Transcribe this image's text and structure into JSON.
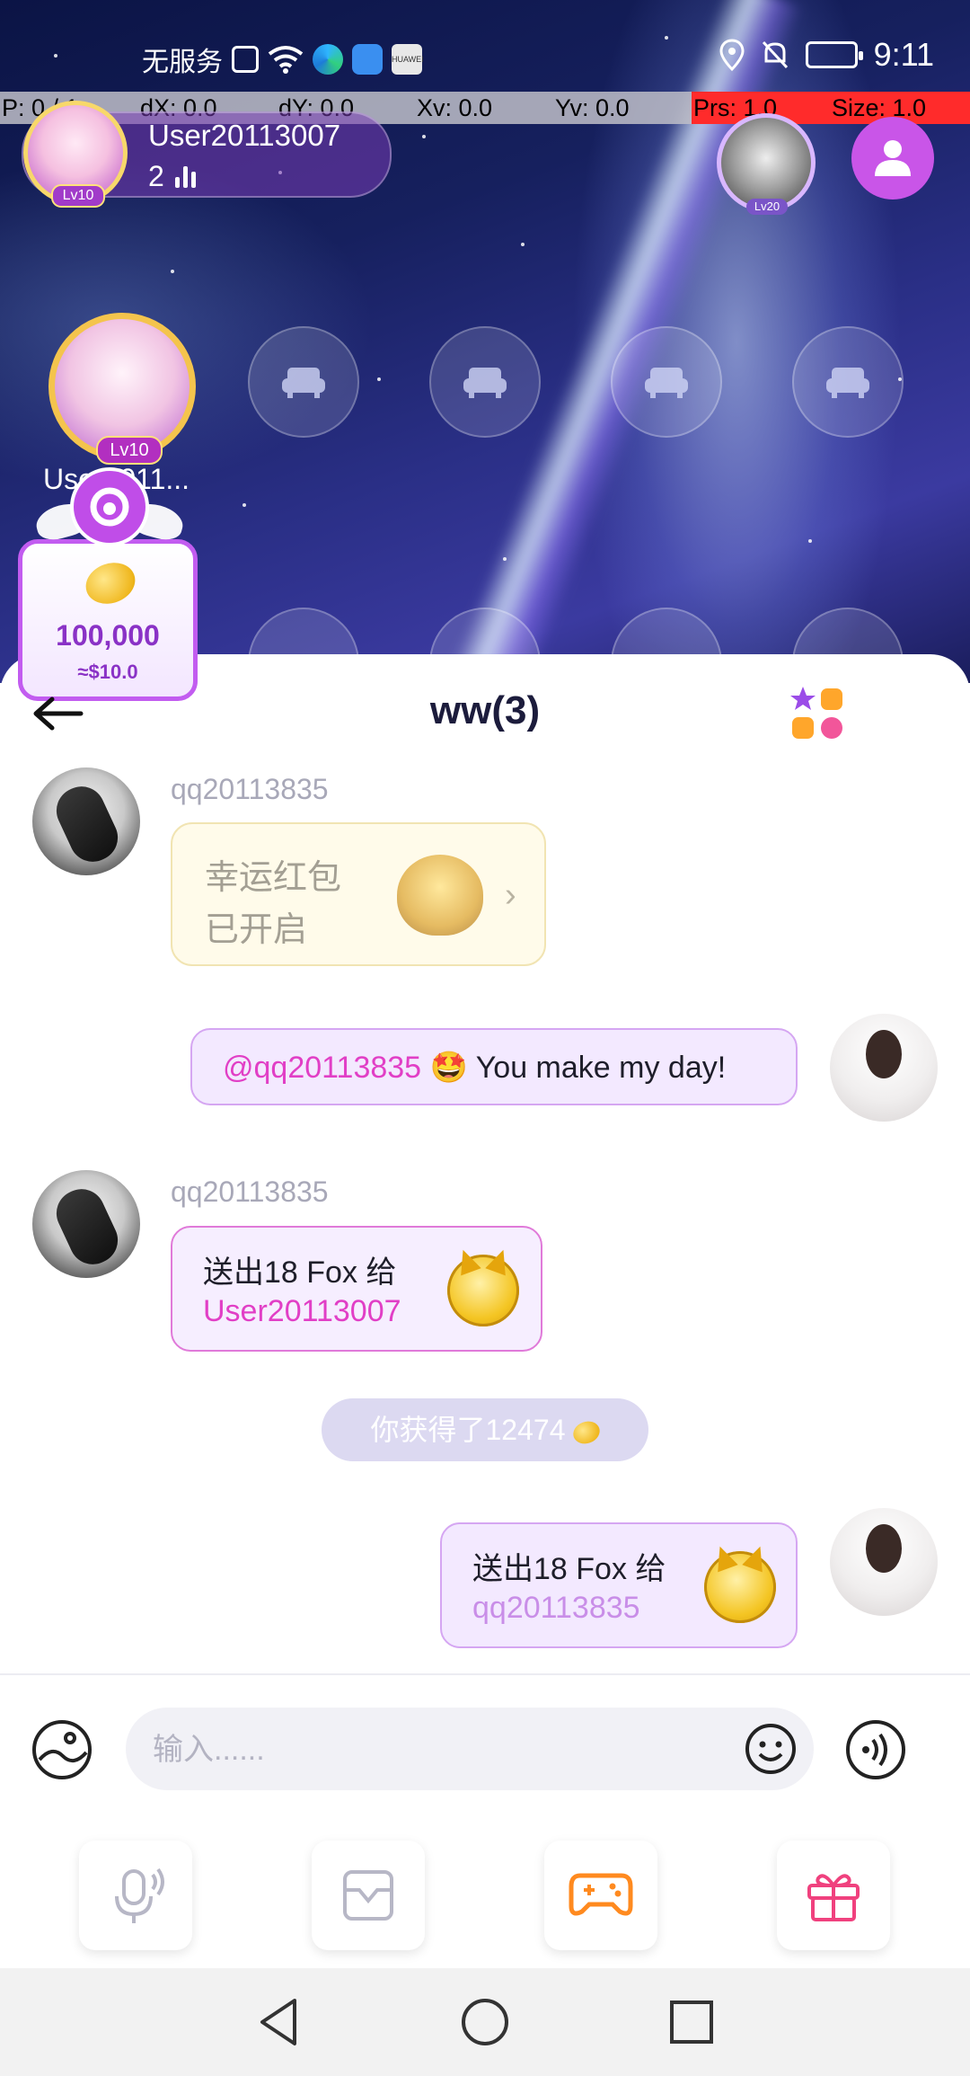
{
  "status_bar": {
    "carrier": "无服务",
    "brand": "HUAWEI",
    "time": "9:11"
  },
  "debug_overlay": {
    "p": "P: 0 / 1",
    "dx": "dX: 0.0",
    "dy": "dY: 0.0",
    "xv": "Xv: 0.0",
    "yv": "Yv: 0.0",
    "prs": "Prs: 1.0",
    "size": "Size: 1.0"
  },
  "room": {
    "host_name": "User20113007",
    "host_level": "Lv10",
    "online_count": "2",
    "top_seat_level": "Lv20",
    "owner_seat_level": "Lv10",
    "owner_seat_name": "User2011..."
  },
  "reward": {
    "amount": "100,000",
    "usd": "≈$10.0"
  },
  "chat": {
    "title": "ww(3)",
    "messages": {
      "m1_sender": "qq20113835",
      "m1_line1": "幸运红包",
      "m1_line2": "已开启",
      "m2_mention": "@qq20113835",
      "m2_emoji": "🤩",
      "m2_text": "You make my day!",
      "m3_sender": "qq20113835",
      "m3_gift_text": "送出18 Fox 给",
      "m3_gift_target": "User20113007",
      "sys_text": "你获得了12474",
      "m4_gift_text": "送出18 Fox 给",
      "m4_gift_target": "qq20113835"
    },
    "input_placeholder": "输入......"
  },
  "colors": {
    "accent": "#c955e8",
    "mention": "#e13fc6",
    "coin": "#f0b820"
  },
  "icons": {
    "back": "arrow-left-icon",
    "apps": "apps-grid-icon",
    "gallery": "image-icon",
    "emoji": "smile-icon",
    "voice": "voice-wave-icon",
    "mic": "microphone-icon",
    "inbox": "inbox-icon",
    "game": "gamepad-icon",
    "gift": "gift-icon",
    "members": "members-icon",
    "seat": "sofa-icon"
  }
}
